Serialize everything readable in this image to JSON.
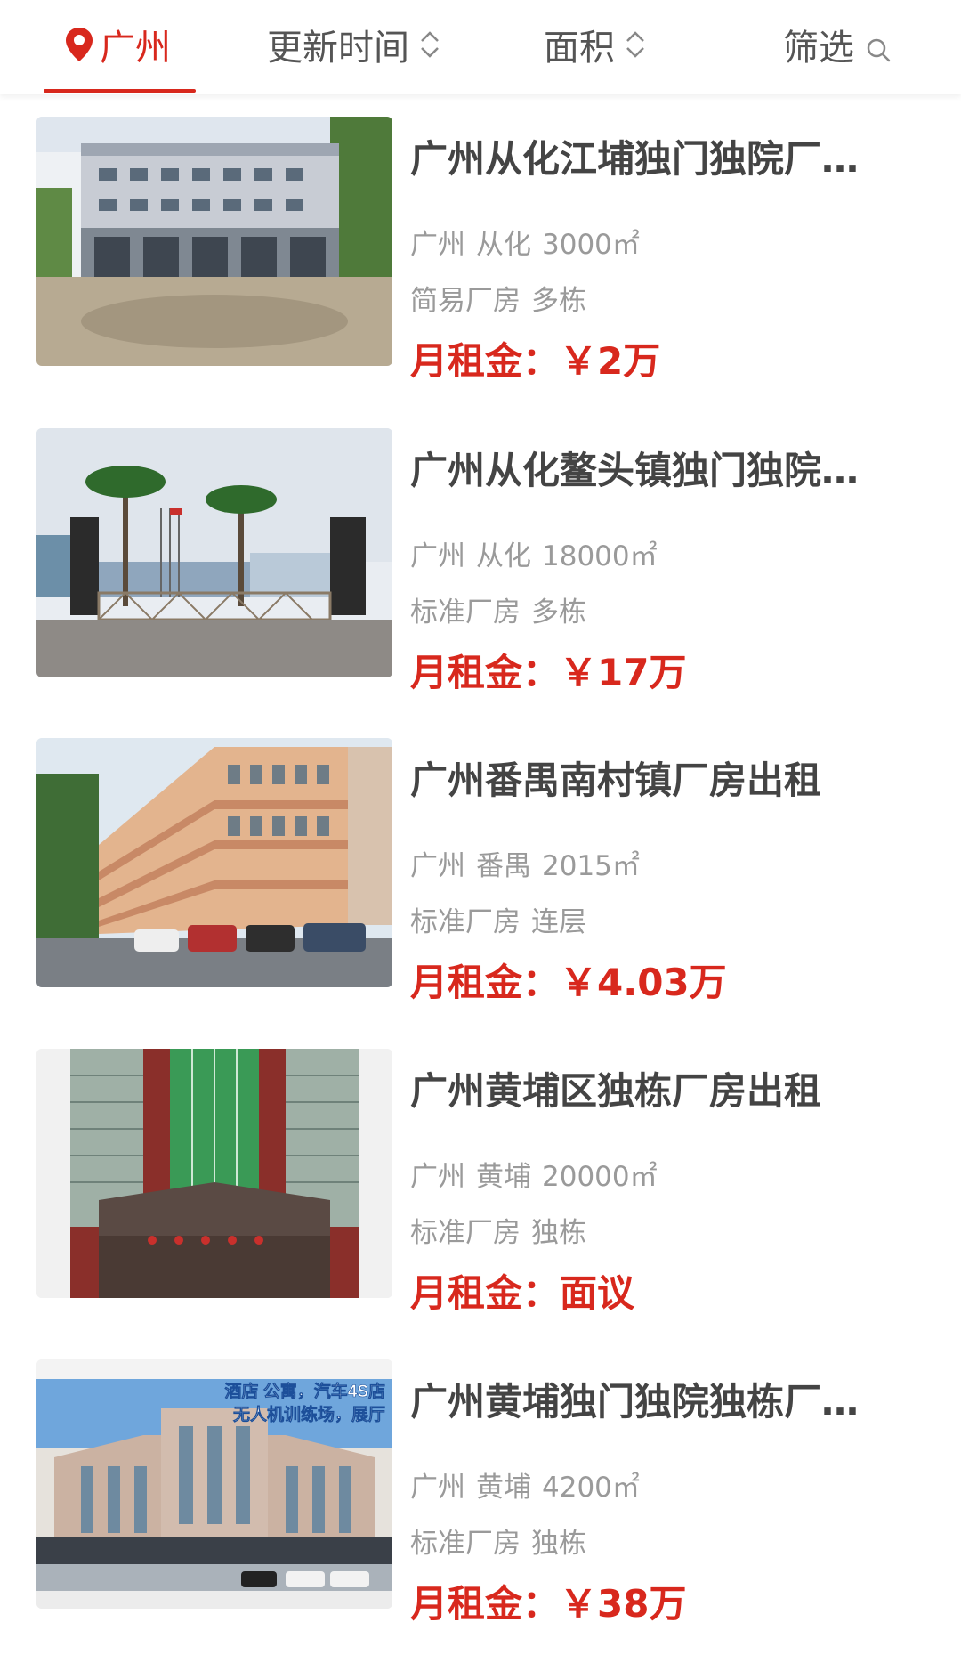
{
  "filter_bar": {
    "city": "广州",
    "update_time": "更新时间",
    "area": "面积",
    "screen": "筛选",
    "accent_color": "#d8281d",
    "icons": {
      "city": "location-pin-icon",
      "update_time": "sort-updown-icon",
      "area": "sort-updown-icon",
      "screen": "search-icon"
    }
  },
  "listings": [
    {
      "title": "广州从化江埔独门独院厂房出租",
      "city": "广州",
      "district": "从化",
      "area": "3000㎡",
      "type": "简易厂房",
      "building": "多栋",
      "price_label": "月租金：",
      "price": "￥2万",
      "image": "white-multistory-factory-photo"
    },
    {
      "title": "广州从化鳌头镇独门独院厂房出租",
      "city": "广州",
      "district": "从化",
      "area": "18000㎡",
      "type": "标准厂房",
      "building": "多栋",
      "price_label": "月租金：",
      "price": "￥17万",
      "image": "factory-gate-palm-trees-photo"
    },
    {
      "title": "广州番禺南村镇厂房出租",
      "city": "广州",
      "district": "番禺",
      "area": "2015㎡",
      "type": "标准厂房",
      "building": "连层",
      "price_label": "月租金：",
      "price": "￥4.03万",
      "image": "orange-stripe-factory-building-photo"
    },
    {
      "title": "广州黄埔区独栋厂房出租",
      "city": "广州",
      "district": "黄埔",
      "area": "20000㎡",
      "type": "标准厂房",
      "building": "独栋",
      "price_label": "月租金：",
      "price": "面议",
      "image": "green-glass-tower-photo"
    },
    {
      "title": "广州黄埔独门独院独栋厂房出租",
      "city": "广州",
      "district": "黄埔",
      "area": "4200㎡",
      "type": "标准厂房",
      "building": "独栋",
      "price_label": "月租金：",
      "price": "￥38万",
      "image": "hotel-showroom-building-photo",
      "image_caption_1": "酒店 公寓，汽车4S店",
      "image_caption_2": "无人机训练场，展厅"
    }
  ]
}
